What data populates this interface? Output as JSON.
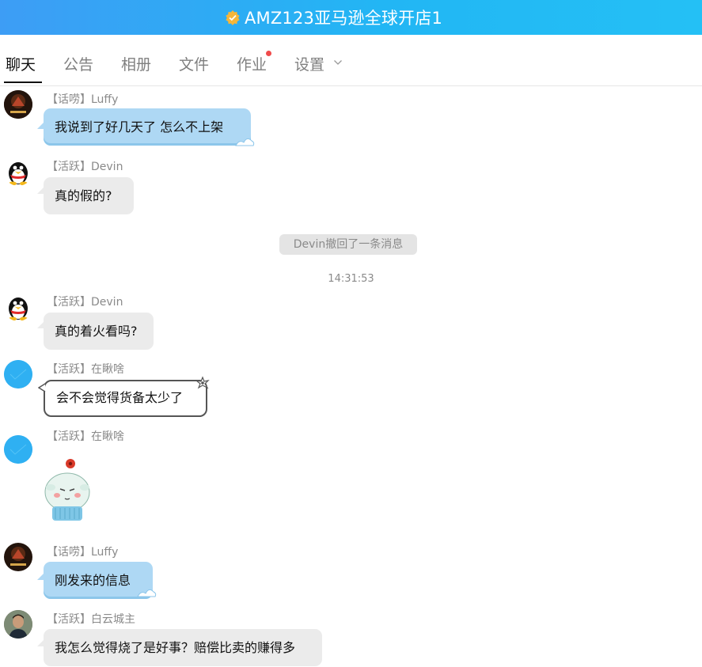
{
  "header": {
    "title": "AMZ123亚马逊全球开店1",
    "badge_icon": "verified-badge-icon",
    "background_start": "#3d9df5",
    "background_end": "#24c0f5"
  },
  "tabs": [
    {
      "label": "聊天",
      "active": true
    },
    {
      "label": "公告",
      "active": false
    },
    {
      "label": "相册",
      "active": false
    },
    {
      "label": "文件",
      "active": false
    },
    {
      "label": "作业",
      "active": false,
      "notification_dot": true
    },
    {
      "label": "设置",
      "active": false,
      "dropdown": true
    }
  ],
  "messages": [
    {
      "sender": "【话唠】Luffy",
      "text": "我说到了好几天了 怎么不上架",
      "bubble": "blue"
    },
    {
      "sender": "【活跃】Devin",
      "text": "真的假的?",
      "bubble": "gray"
    },
    {
      "sender": "【活跃】Devin",
      "text": "真的着火看吗?",
      "bubble": "gray"
    },
    {
      "sender": "【活跃】在瞅啥",
      "text": "会不会觉得货备太少了",
      "bubble": "outline"
    },
    {
      "sender": "【活跃】在瞅啥",
      "sticker": "sheep-sticker-icon"
    },
    {
      "sender": "【话唠】Luffy",
      "text": "刚发来的信息",
      "bubble": "blue"
    },
    {
      "sender": "【活跃】白云城主",
      "text": "我怎么觉得烧了是好事？赔偿比卖的赚得多",
      "bubble": "gray"
    }
  ],
  "system": {
    "recall_notice": "Devin撤回了一条消息",
    "timestamp": "14:31:53"
  },
  "colors": {
    "accent": "#22b6f4",
    "blue_bubble": "#aed8f4",
    "gray_bubble": "#ebebeb",
    "notification": "#f04b4b"
  }
}
